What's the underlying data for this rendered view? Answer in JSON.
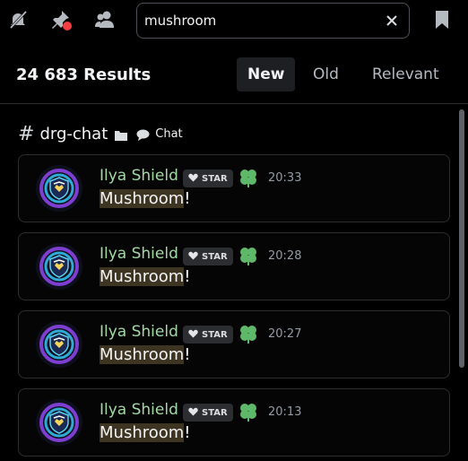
{
  "toolbar": {
    "icons": [
      "muted-bell-icon",
      "unpin-icon",
      "members-icon",
      "bookmark-icon"
    ],
    "search": {
      "value": "mushroom",
      "placeholder": "Search"
    }
  },
  "results_bar": {
    "count": "24 683 Results",
    "tabs": [
      {
        "label": "New",
        "active": true
      },
      {
        "label": "Old",
        "active": false
      },
      {
        "label": "Relevant",
        "active": false
      }
    ]
  },
  "channel": {
    "hash": "#",
    "name": "drg-chat",
    "category": "Chat"
  },
  "messages": [
    {
      "author": "Ilya Shield",
      "badge": "STAR",
      "time": "20:33",
      "text_match": "Mushroom",
      "text_rest": "!"
    },
    {
      "author": "Ilya Shield",
      "badge": "STAR",
      "time": "20:28",
      "text_match": "Mushroom",
      "text_rest": "!"
    },
    {
      "author": "Ilya Shield",
      "badge": "STAR",
      "time": "20:27",
      "text_match": "Mushroom",
      "text_rest": "!"
    },
    {
      "author": "Ilya Shield",
      "badge": "STAR",
      "time": "20:13",
      "text_match": "Mushroom",
      "text_rest": "!"
    }
  ],
  "colors": {
    "background": "#000000",
    "author": "#a3d9a5",
    "highlight": "#3d3422",
    "notification_dot": "#f23f43"
  }
}
